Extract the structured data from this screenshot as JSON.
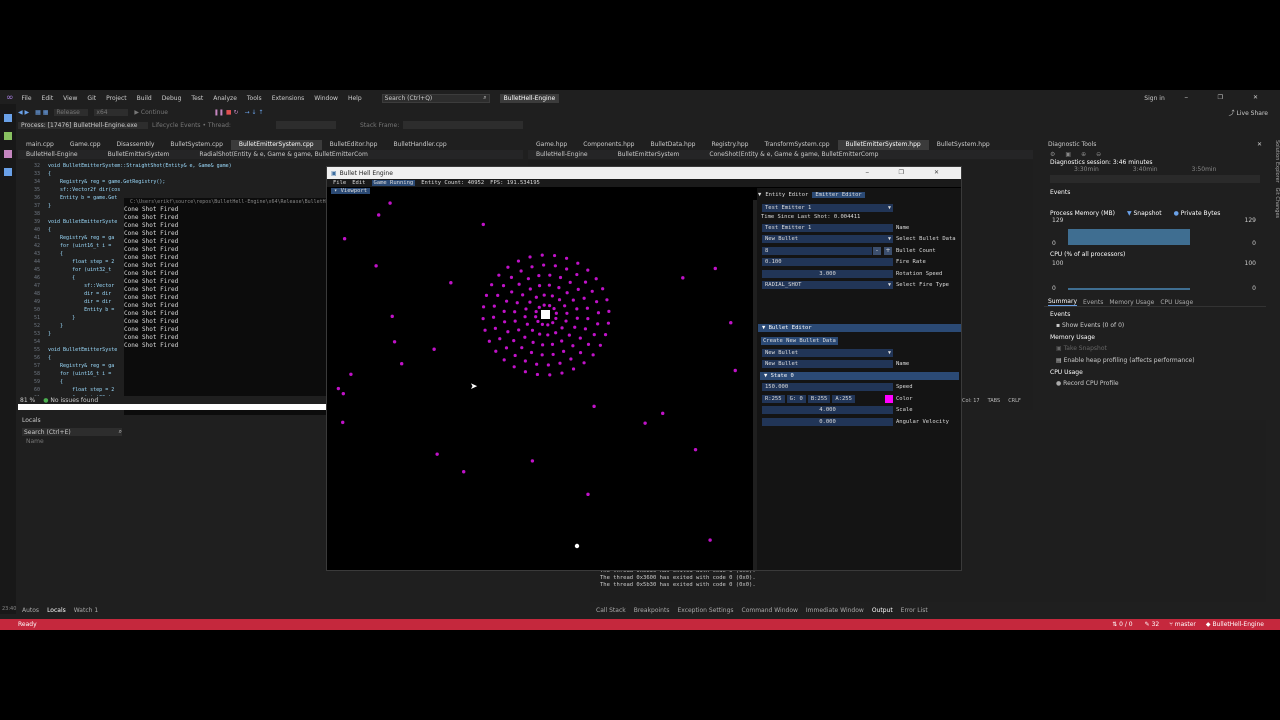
{
  "vs": {
    "menu": [
      "File",
      "Edit",
      "View",
      "Git",
      "Project",
      "Build",
      "Debug",
      "Test",
      "Analyze",
      "Tools",
      "Extensions",
      "Window",
      "Help"
    ],
    "search": "Search (Ctrl+Q)",
    "solution_badge": "BulletHell-Engine",
    "sign_in": "Sign in",
    "process": "Process: [17476] BulletHell-Engine.exe",
    "lifecycle": "Lifecycle Events • Thread:",
    "stack_frame": "Stack Frame:",
    "live_share": "Live Share",
    "release": "Release",
    "x64": "x64",
    "continue": "Continue",
    "left_tabs": [
      "main.cpp",
      "Game.cpp",
      "Disassembly",
      "BulletSystem.cpp",
      "BulletEmitterSystem.cpp",
      "BulletEditor.hpp",
      "BulletHandler.cpp"
    ],
    "right_tabs": [
      "Game.hpp",
      "Components.hpp",
      "BulletData.hpp",
      "Registry.hpp",
      "TransformSystem.cpp",
      "BulletEmitterSystem.hpp",
      "BulletSystem.hpp"
    ],
    "left_nav": [
      "BulletHell-Engine",
      "BulletEmitterSystem",
      "RadialShot(Entity & e, Game & game, BulletEmitterCom"
    ],
    "right_nav": [
      "BulletHell-Engine",
      "BulletEmitterSystem",
      "ConeShot(Entity & e, Game & game, BulletEmitterComp"
    ],
    "code_lines": [
      {
        "n": "32",
        "t": "void BulletEmitterSystem::StraightShot(Entity& e, Game& game)"
      },
      {
        "n": "33",
        "t": "{"
      },
      {
        "n": "34",
        "t": "    Registry& reg = game.GetRegistry();"
      },
      {
        "n": "35",
        "t": "    sf::Vector2f dir(cos"
      },
      {
        "n": "36",
        "t": "    Entity b = game.Get"
      },
      {
        "n": "37",
        "t": "}"
      },
      {
        "n": "38",
        "t": ""
      },
      {
        "n": "39",
        "t": "void BulletEmitterSyste"
      },
      {
        "n": "40",
        "t": "{"
      },
      {
        "n": "41",
        "t": "    Registry& reg = ga"
      },
      {
        "n": "42",
        "t": "    for (uint16_t i ="
      },
      {
        "n": "43",
        "t": "    {"
      },
      {
        "n": "44",
        "t": "        float step = 2"
      },
      {
        "n": "45",
        "t": "        for (uint32_t"
      },
      {
        "n": "46",
        "t": "        {"
      },
      {
        "n": "47",
        "t": "            sf::Vector"
      },
      {
        "n": "48",
        "t": "            dir = dir"
      },
      {
        "n": "49",
        "t": "            dir = dir"
      },
      {
        "n": "50",
        "t": "            Entity b ="
      },
      {
        "n": "51",
        "t": "        }"
      },
      {
        "n": "52",
        "t": "    }"
      },
      {
        "n": "53",
        "t": "}"
      },
      {
        "n": "54",
        "t": ""
      },
      {
        "n": "55",
        "t": "void BulletEmitterSyste"
      },
      {
        "n": "56",
        "t": "{"
      },
      {
        "n": "57",
        "t": "    Registry& reg = ga"
      },
      {
        "n": "58",
        "t": "    for (uint16_t i ="
      },
      {
        "n": "59",
        "t": "    {"
      },
      {
        "n": "60",
        "t": "        float step = 2"
      },
      {
        "n": "61",
        "t": "        for (uint32_t"
      },
      {
        "n": "62",
        "t": "        {"
      },
      {
        "n": "63",
        "t": "            sf::Vector"
      }
    ],
    "console_path": "C:\\Users\\erikf\\source\\repos\\BulletHell-Engine\\x64\\Release\\BulletHell-",
    "console_line": "Cone Shot Fired",
    "console_count": 18,
    "zoom": "81 %",
    "issues": "No issues found",
    "locals_title": "Locals",
    "locals_search": "Search (Ctrl+E)",
    "locals_col": "Name",
    "bottom_tabs_left": [
      "Autos",
      "Locals",
      "Watch 1"
    ],
    "bottom_tabs_right": [
      "Call Stack",
      "Breakpoints",
      "Exception Settings",
      "Command Window",
      "Immediate Window",
      "Output",
      "Error List"
    ],
    "output_lines": [
      "The thread 0x5b30 has exited with code 0 (0x0).",
      "The thread 0x3600 has exited with code 0 (0x0).",
      "The thread 0x5b30 has exited with code 0 (0x0)."
    ],
    "status_ready": "Ready",
    "status_errors": "0 / 0",
    "status_lines": "32",
    "status_branch": "master",
    "status_repo": "BulletHell-Engine",
    "col_info": "Col: 17",
    "tabs_info": "TABS",
    "crlf": "CRLF",
    "taskbar_time": "23:40",
    "diag": {
      "title": "Diagnostic Tools",
      "session": "Diagnostics session: 3:46 minutes",
      "t1": "3:30min",
      "t2": "3:40min",
      "t3": "3:50min",
      "events_label": "Events",
      "mem_label": "Process Memory (MB)",
      "snapshot": "Snapshot",
      "private_bytes": "Private Bytes",
      "mem_max": "129",
      "mem_min": "0",
      "cpu_label": "CPU (% of all processors)",
      "cpu_max": "100",
      "cpu_min": "0",
      "tabs": [
        "Summary",
        "Events",
        "Memory Usage",
        "CPU Usage"
      ],
      "events_h": "Events",
      "show_events": "Show Events (0 of 0)",
      "mem_usage_h": "Memory Usage",
      "take_snapshot": "Take Snapshot",
      "heap": "Enable heap profiling (affects performance)",
      "cpu_usage_h": "CPU Usage",
      "record_cpu": "Record CPU Profile",
      "mem_fill": 0.62,
      "cpu_fill": 0.05
    },
    "side_tabs": [
      "Solution Explorer",
      "Git Changes"
    ]
  },
  "app": {
    "window_title": "Bullet Hell Engine",
    "menu": [
      "File",
      "Edit",
      "Game Running"
    ],
    "entity_count": "Entity Count: 40952",
    "fps": "FPS: 191.534195",
    "viewport_label": "Viewport",
    "tabs": [
      "Entity Editor",
      "Emitter Editor"
    ],
    "time_since": "Time Since Last Shot: 0.004411",
    "emitter_select": "Test Emitter 1",
    "name_value": "Test Emitter 1",
    "name_label": "Name",
    "bullet_data": "New Bullet",
    "bullet_data_label": "Select Bullet Data",
    "bullet_count": "8",
    "bullet_count_label": "Bullet Count",
    "fire_rate": "0.100",
    "fire_rate_label": "Fire Rate",
    "rotation_speed": "3.000",
    "rotation_label": "Rotation Speed",
    "fire_type": "RADIAL_SHOT",
    "fire_type_label": "Select Fire Type",
    "bullet_editor_h": "Bullet Editor",
    "create_btn": "Create New Bullet Data",
    "bullet_select": "New Bullet",
    "bullet_name": "New Bullet",
    "bullet_name_label": "Name",
    "state_h": "State 0",
    "speed": "150.000",
    "speed_label": "Speed",
    "r": "R:255",
    "g": "G:  0",
    "b": "B:255",
    "a": "A:255",
    "color_label": "Color",
    "color_hex": "#ff00ff",
    "scale": "4.000",
    "scale_label": "Scale",
    "ang_vel": "0.000",
    "ang_vel_label": "Angular Velocity",
    "bullet_color": "#c012c8"
  }
}
